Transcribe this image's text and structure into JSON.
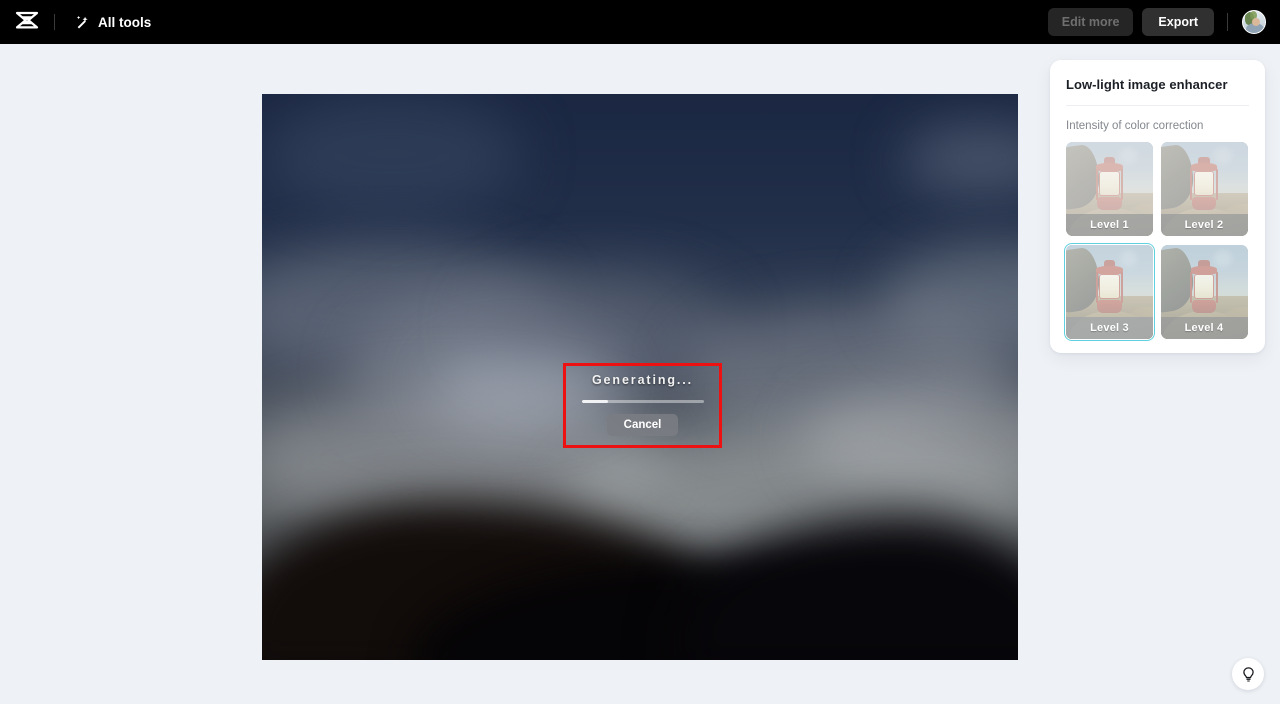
{
  "topbar": {
    "logo_icon": "capcut-logo-icon",
    "all_tools_label": "All tools",
    "all_tools_icon": "magic-wand-icon",
    "edit_more_label": "Edit more",
    "export_label": "Export",
    "avatar_name": "user-avatar"
  },
  "canvas": {
    "image_description": "Blurred night sky with clouds over dark silhouetted hills",
    "dialog": {
      "title": "Generating...",
      "cancel_label": "Cancel",
      "progress_percent": 22
    },
    "annotation_color": "#ee1111"
  },
  "panel": {
    "title": "Low-light image enhancer",
    "subtitle": "Intensity of color correction",
    "selected_index": 2,
    "selection_color": "#5fd0e0",
    "levels": [
      {
        "label": "Level 1"
      },
      {
        "label": "Level 2"
      },
      {
        "label": "Level 3"
      },
      {
        "label": "Level 4"
      }
    ]
  },
  "help": {
    "icon": "lightbulb-icon"
  },
  "colors": {
    "page_background": "#eef1f5",
    "topbar_background": "#000000",
    "panel_background": "#ffffff",
    "sky_dark": "#1b2740",
    "cloud_gray": "#585b60"
  }
}
